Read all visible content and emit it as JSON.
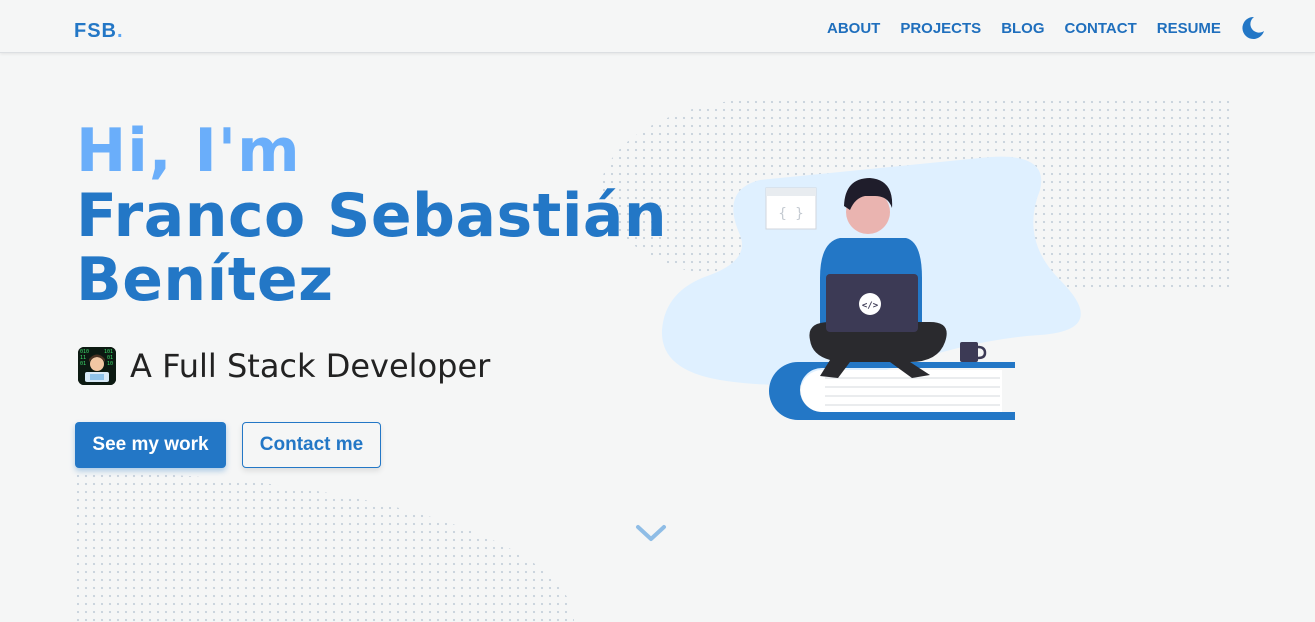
{
  "nav": {
    "logo": "FSB",
    "logo_dot": ".",
    "links": [
      "ABOUT",
      "PROJECTS",
      "BLOG",
      "CONTACT",
      "RESUME"
    ],
    "theme_icon": "moon-icon"
  },
  "hero": {
    "greeting": "Hi, I'm",
    "name": "Franco Sebastián Benítez",
    "role": "A Full Stack Developer",
    "primary_cta": "See my work",
    "secondary_cta": "Contact me",
    "scroll_icon": "chevron-down-icon"
  },
  "colors": {
    "primary": "#2377c6",
    "accent_light": "#6aaefa",
    "background": "#f5f6f6"
  }
}
